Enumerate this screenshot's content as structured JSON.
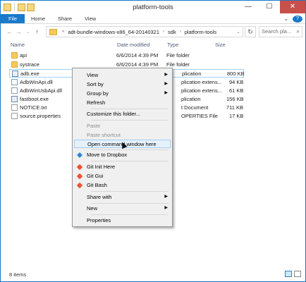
{
  "window": {
    "title": "platform-tools",
    "controls": {
      "min": "—",
      "max": "☐",
      "close": "✕"
    }
  },
  "ribbon": {
    "file": "File",
    "tabs": [
      "Home",
      "Share",
      "View"
    ],
    "expand": "⌄",
    "help": "?"
  },
  "nav": {
    "back": "←",
    "forward": "→",
    "recent": "⌄",
    "up": "↑"
  },
  "address": {
    "overflow": "«",
    "segments": [
      "adt-bundle-windows-x86_64-20140321",
      "sdk",
      "platform-tools"
    ],
    "sep": "›",
    "dropdown": "⌄"
  },
  "search": {
    "placeholder": "Search pla...",
    "icon": "⌕"
  },
  "columns": {
    "name": "Name",
    "date": "Date modified",
    "type": "Type",
    "size": "Size"
  },
  "files": [
    {
      "name": "api",
      "date": "6/6/2014 4:39 PM",
      "type": "File folder",
      "size": "",
      "icon": "folder"
    },
    {
      "name": "systrace",
      "date": "6/6/2014 4:39 PM",
      "type": "File folder",
      "size": "",
      "icon": "folder"
    },
    {
      "name": "adb.exe",
      "date": "",
      "type": "plication",
      "size": "800 KB",
      "icon": "exe"
    },
    {
      "name": "AdbWinApi.dll",
      "date": "",
      "type": "plication extens...",
      "size": "94 KB",
      "icon": "dll"
    },
    {
      "name": "AdbWinUsbApi.dll",
      "date": "",
      "type": "plication extens...",
      "size": "61 KB",
      "icon": "dll"
    },
    {
      "name": "fastboot.exe",
      "date": "",
      "type": "plication",
      "size": "156 KB",
      "icon": "exe"
    },
    {
      "name": "NOTICE.txt",
      "date": "",
      "type": "t Document",
      "size": "711 KB",
      "icon": "txt"
    },
    {
      "name": "source.properties",
      "date": "",
      "type": "OPERTIES File",
      "size": "17 KB",
      "icon": "txt"
    }
  ],
  "context_menu": {
    "items": [
      {
        "label": "View",
        "sub": true
      },
      {
        "label": "Sort by",
        "sub": true
      },
      {
        "label": "Group by",
        "sub": true
      },
      {
        "label": "Refresh",
        "sub": false
      },
      {
        "label": "Customize this folder...",
        "sub": false
      },
      {
        "label": "Paste",
        "sub": false,
        "disabled": true
      },
      {
        "label": "Paste shortcut",
        "sub": false,
        "disabled": true
      },
      {
        "label": "Open command window here",
        "sub": false,
        "highlighted": true
      },
      {
        "label": "Move to Dropbox",
        "sub": false,
        "icon": "dropbox-icon"
      },
      {
        "label": "Git Init Here",
        "sub": false,
        "icon": "git-icon"
      },
      {
        "label": "Git Gui",
        "sub": false,
        "icon": "git-icon"
      },
      {
        "label": "Git Bash",
        "sub": false,
        "icon": "git-icon"
      },
      {
        "label": "Share with",
        "sub": true
      },
      {
        "label": "New",
        "sub": true
      },
      {
        "label": "Properties",
        "sub": false
      }
    ],
    "submenu_arrow": "▶"
  },
  "status": {
    "count": "8 items"
  },
  "colors": {
    "accent": "#1979ca",
    "close": "#c7504a",
    "menu_highlight": "#e5f1fb",
    "selection_border": "#99d1ff"
  }
}
